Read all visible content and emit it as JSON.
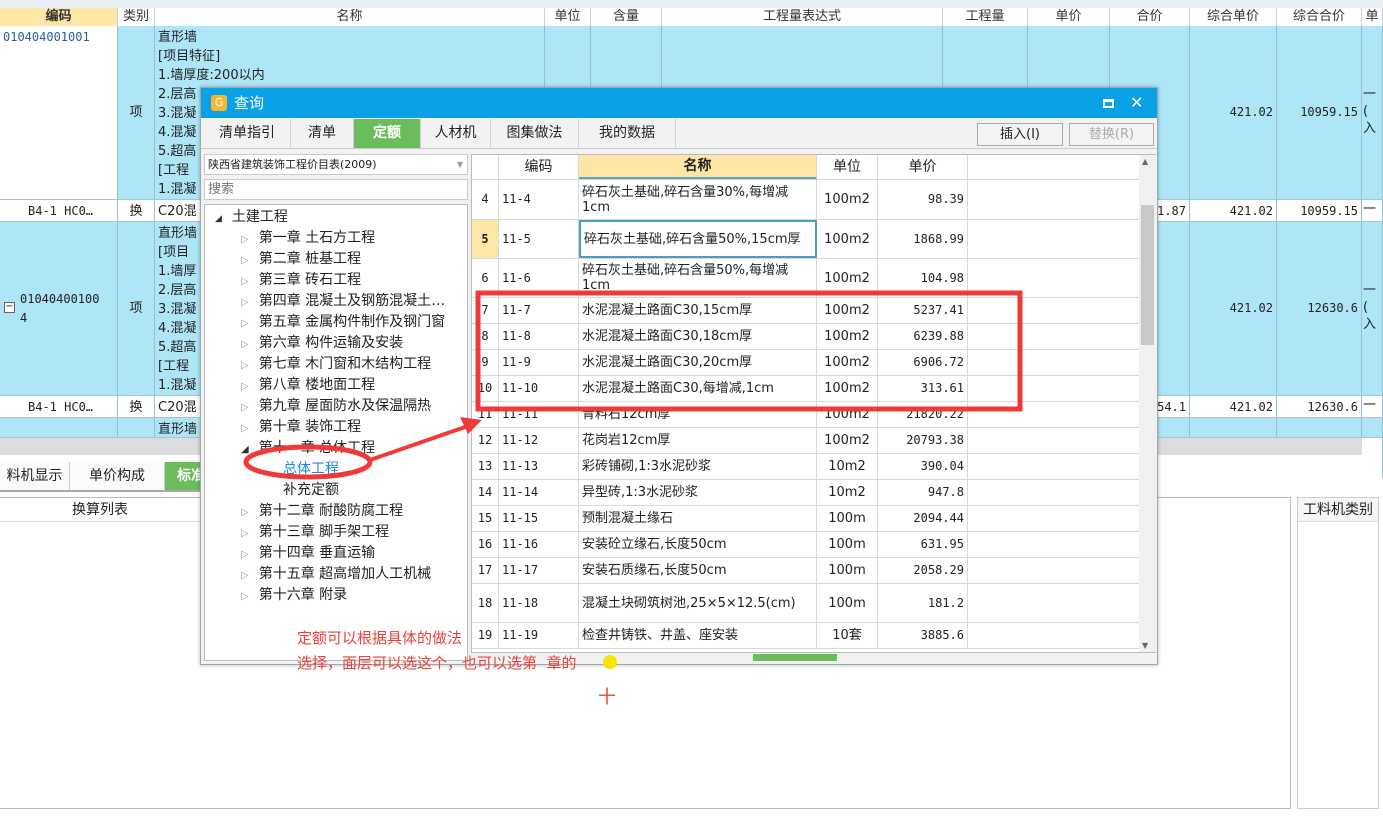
{
  "main_table": {
    "headers": [
      "编码",
      "类别",
      "名称",
      "单位",
      "含量",
      "工程量表达式",
      "工程量",
      "单价",
      "合价",
      "综合单价",
      "综合合价",
      "单"
    ],
    "rows": [
      {
        "code": "010404001001",
        "type": "项",
        "name": "直形墙\n[项目特征]\n1.墙厚度:200以内\n2.层高\n3.混凝\n4.混凝\n5.超高\n[工程\n1.混凝",
        "unit_price": "421.02",
        "total": "10959.15",
        "extra": "一\n(\n入",
        "style": "blue"
      },
      {
        "code": "B4-1 HC0…",
        "type": "换",
        "name": "C20混",
        "sum": "1.87",
        "unit_price": "421.02",
        "total": "10959.15",
        "extra": "一",
        "style": "white"
      },
      {
        "code": "01040400100\n4",
        "type": "项",
        "name": "直形墙\n[项目\n1.墙厚\n2.层高\n3.混凝\n4.混凝\n5.超高\n[工程\n1.混凝",
        "unit_price": "421.02",
        "total": "12630.6",
        "extra": "一\n(\n入",
        "style": "blue"
      },
      {
        "code": "B4-1 HC0…",
        "type": "换",
        "name": "C20混",
        "sum": "54.1",
        "unit_price": "421.02",
        "total": "12630.6",
        "extra": "一",
        "style": "white"
      },
      {
        "code": "",
        "type": "",
        "name": "直形墙",
        "style": "blue"
      }
    ]
  },
  "bottom": {
    "tabs": [
      "料机显示",
      "单价构成",
      "标准"
    ],
    "list_header": "换算列表",
    "right_header": "工料机类别"
  },
  "dialog": {
    "title": "查询",
    "tabs": [
      "清单指引",
      "清单",
      "定额",
      "人材机",
      "图集做法",
      "我的数据"
    ],
    "active_tab": "定额",
    "insert_button": "插入(I)",
    "replace_button": "替换(R)",
    "library_select": "陕西省建筑装饰工程价目表(2009)",
    "search_placeholder": "搜索",
    "tree": {
      "root": "土建工程",
      "items": [
        {
          "label": "第一章  土石方工程",
          "level": 1,
          "expanded": false
        },
        {
          "label": "第二章  桩基工程",
          "level": 1,
          "expanded": false
        },
        {
          "label": "第三章  砖石工程",
          "level": 1,
          "expanded": false
        },
        {
          "label": "第四章  混凝土及钢筋混凝土…",
          "level": 1,
          "expanded": false
        },
        {
          "label": "第五章  金属构件制作及钢门窗",
          "level": 1,
          "expanded": false
        },
        {
          "label": "第六章  构件运输及安装",
          "level": 1,
          "expanded": false
        },
        {
          "label": "第七章  木门窗和木结构工程",
          "level": 1,
          "expanded": false
        },
        {
          "label": "第八章  楼地面工程",
          "level": 1,
          "expanded": false
        },
        {
          "label": "第九章  屋面防水及保温隔热",
          "level": 1,
          "expanded": false
        },
        {
          "label": "第十章  装饰工程",
          "level": 1,
          "expanded": false
        },
        {
          "label": "第十一章  总体工程",
          "level": 1,
          "expanded": true
        },
        {
          "label": "总体工程",
          "level": 2,
          "selected": true
        },
        {
          "label": "补充定额",
          "level": 2
        },
        {
          "label": "第十二章  耐酸防腐工程",
          "level": 1,
          "expanded": false
        },
        {
          "label": "第十三章  脚手架工程",
          "level": 1,
          "expanded": false
        },
        {
          "label": "第十四章  垂直运输",
          "level": 1,
          "expanded": false
        },
        {
          "label": "第十五章  超高增加人工机械",
          "level": 1,
          "expanded": false
        },
        {
          "label": "第十六章  附录",
          "level": 1,
          "expanded": false
        }
      ]
    },
    "grid": {
      "headers": [
        "",
        "编码",
        "名称",
        "单位",
        "单价"
      ],
      "rows": [
        [
          "4",
          "11-4",
          "碎石灰土基础,碎石含量30%,每增减1cm",
          "100m2",
          "98.39"
        ],
        [
          "5",
          "11-5",
          "碎石灰土基础,碎石含量50%,15cm厚",
          "100m2",
          "1868.99"
        ],
        [
          "6",
          "11-6",
          "碎石灰土基础,碎石含量50%,每增减1cm",
          "100m2",
          "104.98"
        ],
        [
          "7",
          "11-7",
          "水泥混凝土路面C30,15cm厚",
          "100m2",
          "5237.41"
        ],
        [
          "8",
          "11-8",
          "水泥混凝土路面C30,18cm厚",
          "100m2",
          "6239.88"
        ],
        [
          "9",
          "11-9",
          "水泥混凝土路面C30,20cm厚",
          "100m2",
          "6906.72"
        ],
        [
          "10",
          "11-10",
          "水泥混凝土路面C30,每增减,1cm",
          "100m2",
          "313.61"
        ],
        [
          "11",
          "11-11",
          "青料石12cm厚",
          "100m2",
          "21820.22"
        ],
        [
          "12",
          "11-12",
          "花岗岩12cm厚",
          "100m2",
          "20793.38"
        ],
        [
          "13",
          "11-13",
          "彩砖铺砌,1:3水泥砂浆",
          "10m2",
          "390.04"
        ],
        [
          "14",
          "11-14",
          "异型砖,1:3水泥砂浆",
          "10m2",
          "947.8"
        ],
        [
          "15",
          "11-15",
          "预制混凝土缘石",
          "100m",
          "2094.44"
        ],
        [
          "16",
          "11-16",
          "安装砼立缘石,长度50cm",
          "100m",
          "631.95"
        ],
        [
          "17",
          "11-17",
          "安装石质缘石,长度50cm",
          "100m",
          "2058.29"
        ],
        [
          "18",
          "11-18",
          "混凝土块砌筑树池,25×5×12.5(cm)",
          "100m",
          "181.2"
        ],
        [
          "19",
          "11-19",
          "检查井铸铁、井盖、座安装",
          "10套",
          "3885.6"
        ]
      ],
      "selected_row": "5"
    }
  },
  "annotation": {
    "line1": "定额可以根据具体的做法",
    "line2": "选择，面层可以选这个，也可以选第  章的",
    "line3": "十",
    "color": "#e8433d"
  },
  "colors": {
    "title_bar": "#0ba1e6",
    "active_tab": "#6bbd5b",
    "row_highlight": "#aee6f8",
    "header_yellow": "#fde6a6"
  }
}
